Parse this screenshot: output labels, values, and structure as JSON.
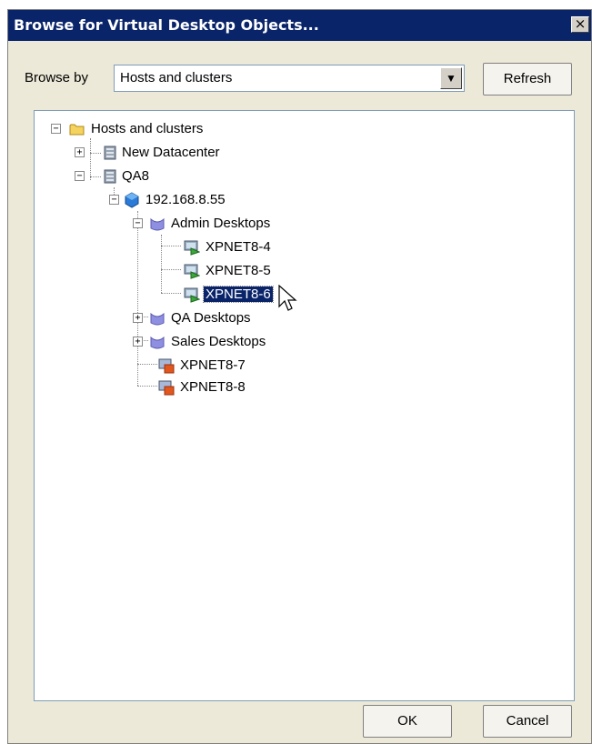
{
  "window": {
    "title": "Browse for Virtual Desktop Objects...",
    "close_glyph": "×"
  },
  "browse": {
    "label": "Browse by",
    "selected": "Hosts and clusters",
    "arrow_glyph": "▼"
  },
  "buttons": {
    "refresh": "Refresh",
    "ok": "OK",
    "cancel": "Cancel"
  },
  "tree": [
    {
      "label": "Hosts and clusters",
      "icon": "folder-icon",
      "expander": "−",
      "selected": false
    },
    {
      "label": "New Datacenter",
      "icon": "datacenter-icon",
      "expander": "+",
      "selected": false
    },
    {
      "label": "QA8",
      "icon": "datacenter-icon",
      "expander": "−",
      "selected": false
    },
    {
      "label": "192.168.8.55",
      "icon": "host-icon",
      "expander": "−",
      "selected": false
    },
    {
      "label": "Admin Desktops",
      "icon": "resource-pool-icon",
      "expander": "−",
      "selected": false
    },
    {
      "label": "XPNET8-4",
      "icon": "vm-on-icon",
      "expander": "",
      "selected": false
    },
    {
      "label": "XPNET8-5",
      "icon": "vm-on-icon",
      "expander": "",
      "selected": false
    },
    {
      "label": "XPNET8-6",
      "icon": "vm-on-icon",
      "expander": "",
      "selected": true
    },
    {
      "label": "QA Desktops",
      "icon": "resource-pool-icon",
      "expander": "+",
      "selected": false
    },
    {
      "label": "Sales Desktops",
      "icon": "resource-pool-icon",
      "expander": "+",
      "selected": false
    },
    {
      "label": "XPNET8-7",
      "icon": "vm-off-icon",
      "expander": "",
      "selected": false
    },
    {
      "label": "XPNET8-8",
      "icon": "vm-off-icon",
      "expander": "",
      "selected": false
    }
  ],
  "colors": {
    "title_bar": "#0a246a",
    "selection": "#0a246a",
    "dialog_bg": "#ece9d8"
  }
}
